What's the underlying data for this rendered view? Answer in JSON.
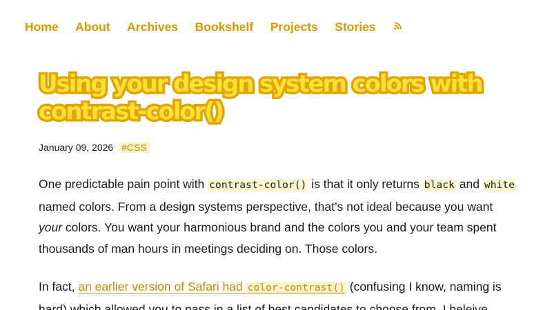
{
  "nav": {
    "items": [
      {
        "label": "Home"
      },
      {
        "label": "About"
      },
      {
        "label": "Archives"
      },
      {
        "label": "Bookshelf"
      },
      {
        "label": "Projects"
      },
      {
        "label": "Stories"
      }
    ],
    "rss_icon": "rss-feed-icon"
  },
  "post": {
    "title": "Using your design system colors with contrast-color()",
    "date": "January 09, 2026",
    "tag": "#CSS"
  },
  "paragraph1": {
    "t1": "One predictable pain point with ",
    "code1": "contrast-color()",
    "t2": " is that it only returns ",
    "code2": "black",
    "t3": " and ",
    "code3": "white",
    "t4": " named colors. From a design systems perspective, that’s not ideal because you want ",
    "em": "your",
    "t5": " colors. You want your harmonious brand and the colors you and your team spent thousands of man hours in meetings deciding on. Those colors."
  },
  "paragraph2": {
    "t1": "In fact, ",
    "link_text": "an earlier version of Safari had ",
    "link_code": "color-contrast()",
    "t2": " (confusing I know, naming is hard) which allowed you to pass in a list of best candidates to choose from. I beleive"
  },
  "colors": {
    "accent": "#d49a00",
    "title_fill": "#fde13a",
    "title_stroke": "#e3a300",
    "code_bg": "#fdf3cc",
    "text": "#1a1a1a",
    "background": "#ffffff"
  }
}
